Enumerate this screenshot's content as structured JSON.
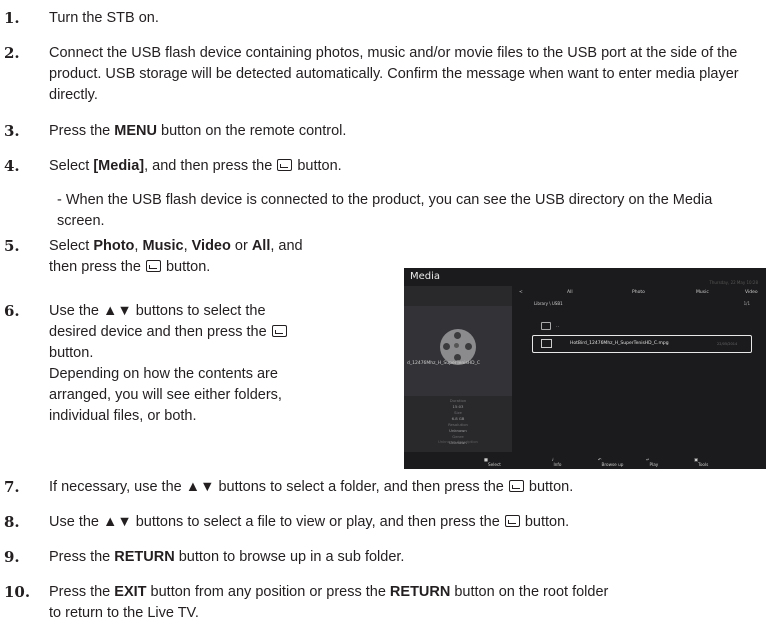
{
  "steps": [
    {
      "n": "1.",
      "parts": [
        "Turn the STB on."
      ]
    },
    {
      "n": "2.",
      "text": "Connect the USB flash device containing photos, music and/or movie files to the USB port at the side of the product. USB storage will be detected automatically. Confirm the message when want to enter media player directly."
    },
    {
      "n": "3.",
      "a": "Press the ",
      "b": "MENU",
      "c": " button on the remote control."
    },
    {
      "n": "4.",
      "a": "Select ",
      "b": "[Media]",
      "c": ", and then press the ",
      "d": " button."
    },
    {
      "n": "5.",
      "a": "Select ",
      "b1": "Photo",
      "s1": ", ",
      "b2": "Music",
      "s2": ", ",
      "b3": "Video",
      "s3": " or ",
      "b4": "All",
      "s4": ", and",
      "line2a": "then press the ",
      "line2b": " button."
    },
    {
      "n": "6.",
      "l1": "Use the ▲▼ buttons to select the",
      "l2": "desired device and then press the ",
      "l3": "button.",
      "l4": "Depending on how the contents are",
      "l5": "arranged, you will see either folders,",
      "l6": "individual files, or both."
    },
    {
      "n": "7.",
      "a": "If necessary, use the ▲▼ buttons to select a folder, and then press the ",
      "c": " button."
    },
    {
      "n": "8.",
      "a": "Use the ▲▼ buttons to select a file to view or play, and then press the ",
      "c": " button."
    },
    {
      "n": "9.",
      "a": "Press the ",
      "b": "RETURN",
      "c": " button to browse up in a sub folder."
    },
    {
      "n": "10.",
      "a": "Press the ",
      "b": "EXIT",
      "c": " button from any position or press the ",
      "d": "RETURN",
      "e": " button on the root folder",
      "f": "to return to the Live TV."
    }
  ],
  "note": "- When the USB flash device is connected to the product, you can see the USB directory on the Media screen.",
  "tv": {
    "title": "Media",
    "date": "Thursday, 22 May 10:28",
    "file_short": "d_12476Mhz_H_SuperTenisHD_C",
    "meta": [
      [
        "Duration",
        "15:03"
      ],
      [
        "Size",
        "6.8 GB"
      ],
      [
        "Resolution",
        "Unknown"
      ],
      [
        "Genre",
        "Unknown"
      ]
    ],
    "description": "Unknown description",
    "tabs": [
      "<",
      "All",
      "Photo",
      "Music",
      "Video",
      ">"
    ],
    "library": "Library \\ USB1",
    "page": "1/1",
    "up": "..",
    "selected_file": "HotBird_12476Mhz_H_SuperTenisHD_C.mpg",
    "selected_date": "22/05/2014",
    "footer": [
      "Select",
      "Info",
      "Browse up",
      "Play",
      "Tools"
    ]
  }
}
